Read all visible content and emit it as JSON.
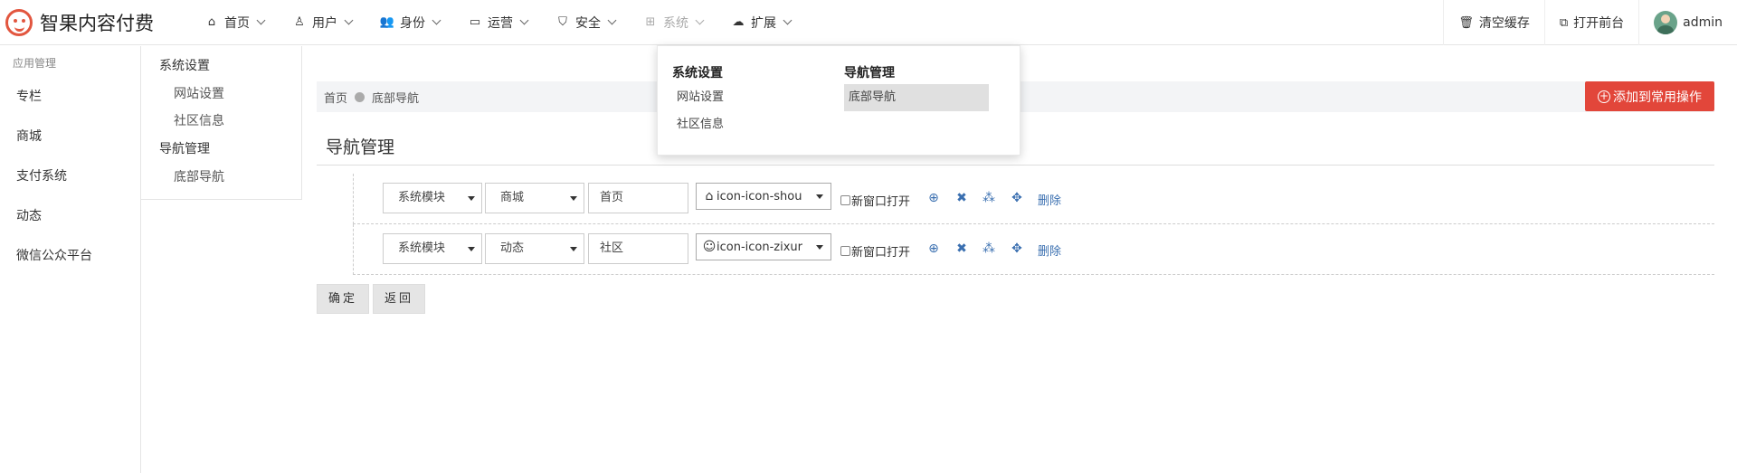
{
  "brand": {
    "name": "智果内容付费",
    "accent": "#e2563f"
  },
  "nav": [
    {
      "label": "首页",
      "icon": "home-icon",
      "glyph": "⌂"
    },
    {
      "label": "用户",
      "icon": "user-icon",
      "glyph": "♙"
    },
    {
      "label": "身份",
      "icon": "users-icon",
      "glyph": "👥"
    },
    {
      "label": "运营",
      "icon": "laptop-icon",
      "glyph": "▭"
    },
    {
      "label": "安全",
      "icon": "shield-icon",
      "glyph": "⛉"
    },
    {
      "label": "系统",
      "icon": "windows-icon",
      "glyph": "⊞"
    },
    {
      "label": "扩展",
      "icon": "cloud-icon",
      "glyph": "☁"
    }
  ],
  "topright": {
    "clear_cache": "清空缓存",
    "open_front": "打开前台",
    "user": "admin"
  },
  "sidebar": {
    "title": "应用管理",
    "items": [
      "专栏",
      "商城",
      "支付系统",
      "动态",
      "微信公众平台"
    ]
  },
  "subnav": {
    "group1": "系统设置",
    "group1_links": [
      "网站设置",
      "社区信息"
    ],
    "group2": "导航管理",
    "group2_links": [
      "底部导航"
    ]
  },
  "breadcrumb": {
    "home": "首页",
    "current": "底部导航"
  },
  "add_button": "添加到常用操作",
  "page_title": "导航管理",
  "rows": [
    {
      "module": "系统模块",
      "target": "商城",
      "name": "首页",
      "icon_value": "icon-icon-shou",
      "icon_glyph": "⌂",
      "new_window": "新窗口打开",
      "delete": "删除"
    },
    {
      "module": "系统模块",
      "target": "动态",
      "name": "社区",
      "icon_value": "icon-icon-zixur",
      "icon_glyph": "☺",
      "new_window": "新窗口打开",
      "delete": "删除"
    }
  ],
  "buttons": {
    "confirm": "确定",
    "back": "返回"
  },
  "dropdown": {
    "col1_head": "系统设置",
    "col1_links": [
      "网站设置",
      "社区信息"
    ],
    "col2_head": "导航管理",
    "col2_links": [
      "底部导航"
    ]
  },
  "colors": {
    "danger": "#e2463a",
    "link": "#3a6fb0"
  }
}
